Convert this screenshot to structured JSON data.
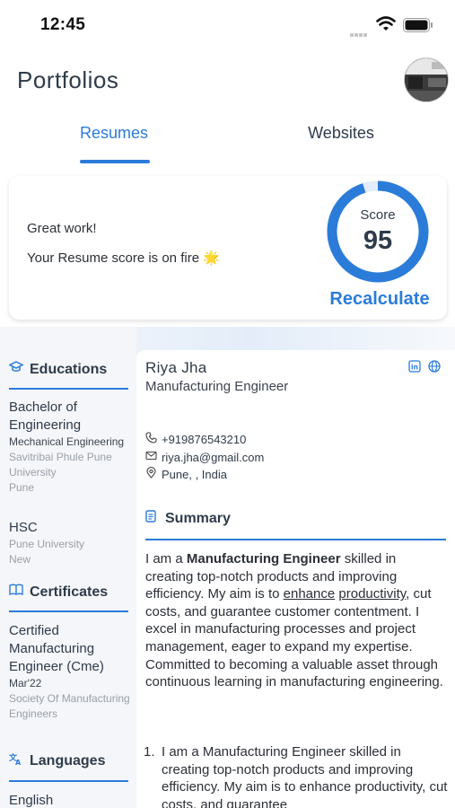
{
  "status_bar": {
    "time": "12:45"
  },
  "header": {
    "title": "Portfolios"
  },
  "tabs": [
    {
      "label": "Resumes",
      "active": true
    },
    {
      "label": "Websites",
      "active": false
    }
  ],
  "score_card": {
    "line1": "Great work!",
    "line2": "Your Resume score is on fire 🌟",
    "score_label": "Score",
    "score_value": "95",
    "score_fraction": 0.95,
    "recalculate_label": "Recalculate"
  },
  "resume": {
    "sections_left": {
      "educations_title": "Educations",
      "educations": [
        {
          "degree": "Bachelor of Engineering",
          "field": "Mechanical Engineering",
          "institution": "Savitribai Phule Pune University",
          "location": "Pune"
        },
        {
          "degree": "HSC",
          "institution": "Pune University",
          "location": "New"
        }
      ],
      "certificates_title": "Certificates",
      "certificates": [
        {
          "name": "Certified Manufacturing Engineer (Cme)",
          "date": "Mar'22",
          "issuer": "Society Of Manufacturing Engineers"
        }
      ],
      "languages_title": "Languages",
      "languages": [
        "English"
      ]
    },
    "name": "Riya Jha",
    "role": "Manufacturing Engineer",
    "phone": "+919876543210",
    "email": "riya.jha@gmail.com",
    "location": "Pune, , India",
    "summary_title": "Summary",
    "summary": {
      "p1": "I am a ",
      "p1_bold": "Manufacturing Engineer",
      "p2": " skilled in creating top-notch products and improving efficiency. My aim is to ",
      "u1": "enhance",
      "p3": " ",
      "u2": "productivity",
      "p4": ", cut costs, and guarantee customer contentment. I excel in manufacturing processes and project management, eager to expand my expertise. Committed to becoming a valuable asset through continuous learning in manufacturing engineering."
    },
    "summary_list": [
      {
        "num": "1.",
        "text": "I am a Manufacturing Engineer skilled in creating top-notch products and improving efficiency. My aim is to enhance productivity, cut costs, and guarantee"
      }
    ]
  },
  "colors": {
    "accent": "#2b7cd9",
    "text": "#2f3b4a"
  },
  "icons": [
    "wifi-icon",
    "battery-icon",
    "graduation-cap-icon",
    "book-icon",
    "translate-icon",
    "phone-icon",
    "mail-icon",
    "location-pin-icon",
    "document-icon",
    "linkedin-icon",
    "globe-icon"
  ]
}
